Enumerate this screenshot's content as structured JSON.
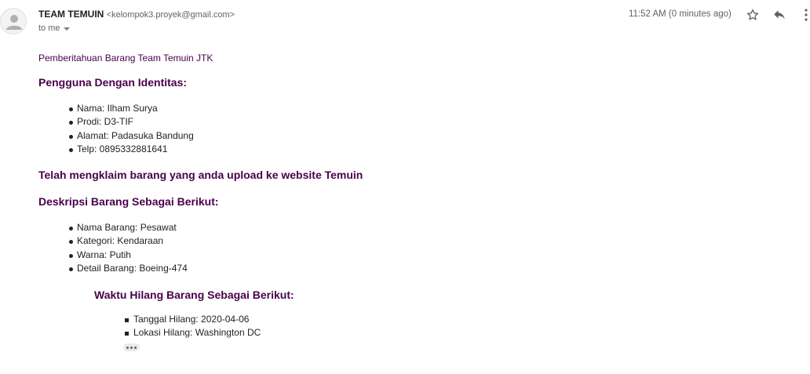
{
  "header": {
    "sender_name": "TEAM TEMUIN",
    "sender_email": "<kelompok3.proyek@gmail.com>",
    "recipient_label": "to me",
    "time": "11:52 AM (0 minutes ago)",
    "icons": [
      "avatar-icon",
      "star-icon",
      "reply-icon",
      "more-vert-icon"
    ]
  },
  "body": {
    "intro": "Pemberitahuan Barang Team Temuin JTK",
    "identity_heading": "Pengguna Dengan Identitas:",
    "identity_items": [
      "Nama: Ilham Surya",
      "Prodi: D3-TIF",
      "Alamat: Padasuka Bandung",
      "Telp: 0895332881641"
    ],
    "claim_heading": "Telah mengklaim barang yang anda upload ke website Temuin",
    "description_heading": "Deskripsi Barang Sebagai Berikut:",
    "description_items": [
      "Nama Barang: Pesawat",
      "Kategori: Kendaraan",
      "Warna: Putih",
      "Detail Barang: Boeing-474"
    ],
    "lost_heading": "Waktu Hilang Barang Sebagai Berikut:",
    "lost_items": [
      "Tanggal Hilang: 2020-04-06",
      "Lokasi Hilang: Washington DC"
    ]
  },
  "colors": {
    "heading": "#4a004a",
    "text": "#222222",
    "muted": "#5f6368"
  }
}
